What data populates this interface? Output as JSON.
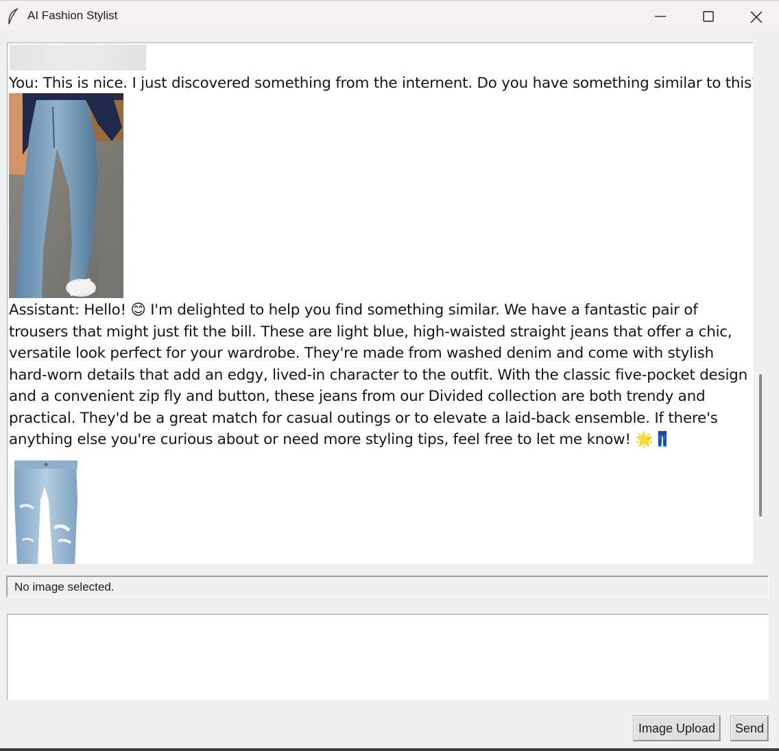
{
  "window": {
    "title": "AI Fashion Stylist",
    "icon": "feather-icon",
    "controls": [
      "minimize-icon",
      "maximize-icon",
      "close-icon"
    ]
  },
  "chat": {
    "user_message": "You: This is nice. I just discovered something from the internent. Do you have something similar to this?",
    "user_image": "photo of person in light blue jeans and navy blazer",
    "assistant_message": "Assistant: Hello! 😊 I'm delighted to help you find something similar. We have a fantastic pair of trousers that might just fit the bill. These are light blue, high-waisted straight jeans that offer a chic, versatile look perfect for your wardrobe. They're made from washed denim and come with stylish hard-worn details that add an edgy, lived-in character to the outfit. With the classic five-pocket design and a convenient zip fly and button, these jeans from our Divided collection are both trendy and practical. They'd be a great match for casual outings or to elevate a laid-back ensemble. If there's anything else you're curious about or need more styling tips, feel free to let me know! 🌟👖",
    "product_image": "light blue ripped straight jeans"
  },
  "status": {
    "text": "No image selected."
  },
  "input": {
    "value": ""
  },
  "buttons": {
    "upload_label": "Image Upload",
    "send_label": "Send"
  },
  "colors": {
    "window_bg": "#f0f0f0",
    "titlebar_bg": "#f6f0f6",
    "chat_bg": "#ffffff",
    "button_bg": "#e1e1e1",
    "denim_light": "#8fb3cf",
    "blazer_navy": "#1f2a4a"
  }
}
